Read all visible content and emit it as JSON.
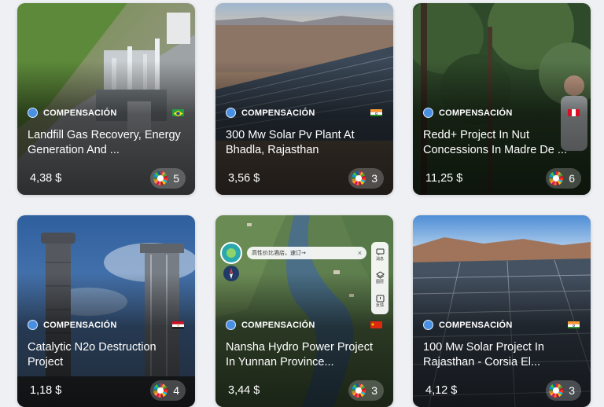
{
  "cards": [
    {
      "category": "COMPENSACIÓN",
      "title": "Landfill Gas Recovery, Energy Generation And ...",
      "price": "4,38 $",
      "sdg_count": "5",
      "flag": "Brazil"
    },
    {
      "category": "COMPENSACIÓN",
      "title": "300 Mw Solar Pv Plant At Bhadla, Rajasthan",
      "price": "3,56 $",
      "sdg_count": "3",
      "flag": "India"
    },
    {
      "category": "COMPENSACIÓN",
      "title": "Redd+ Project In Nut Concessions In Madre De ...",
      "price": "11,25 $",
      "sdg_count": "6",
      "flag": "Peru"
    },
    {
      "category": "COMPENSACIÓN",
      "title": "Catalytic N2o Destruction Project",
      "price": "1,18 $",
      "sdg_count": "4",
      "flag": "Egypt"
    },
    {
      "category": "COMPENSACIÓN",
      "title": "Nansha Hydro Power Project In Yunnan Province...",
      "price": "3,44 $",
      "sdg_count": "3",
      "flag": "China"
    },
    {
      "category": "COMPENSACIÓN",
      "title": "100 Mw Solar Project In Rajasthan - Corsia El...",
      "price": "4,12 $",
      "sdg_count": "3",
      "flag": "India"
    }
  ],
  "map_overlay": {
    "search_text": "高性价比酒店，速订→",
    "btn1": "消息",
    "btn2": "图层",
    "btn3": "反馈"
  }
}
